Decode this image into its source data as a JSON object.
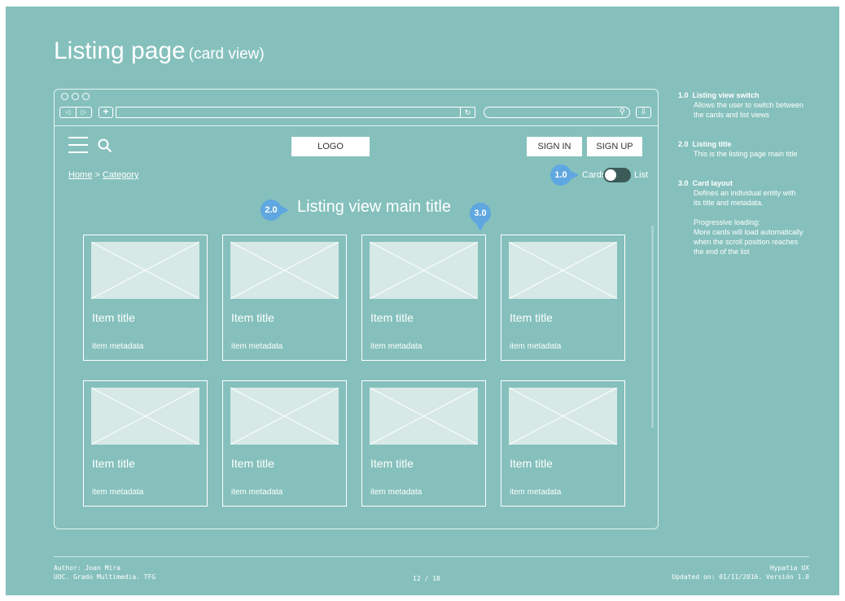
{
  "page": {
    "title": "Listing page",
    "subtitle": "(card view)"
  },
  "browser": {
    "nav_back": "◁",
    "nav_forward": "▷",
    "new_tab": "+",
    "reload": "↻",
    "search_icon": "search-icon",
    "download": "⇩"
  },
  "header": {
    "logo": "LOGO",
    "sign_in": "SIGN IN",
    "sign_up": "SIGN UP"
  },
  "breadcrumb": {
    "home": "Home",
    "separator": ">",
    "category": "Category"
  },
  "view_switch": {
    "cards_label": "Cards",
    "list_label": "List",
    "state": "cards"
  },
  "listing": {
    "title": "Listing view main title"
  },
  "cards": [
    {
      "title": "Item title",
      "metadata": "item metadata"
    },
    {
      "title": "Item title",
      "metadata": "item metadata"
    },
    {
      "title": "Item title",
      "metadata": "item metadata"
    },
    {
      "title": "Item title",
      "metadata": "item metadata"
    },
    {
      "title": "Item title",
      "metadata": "item metadata"
    },
    {
      "title": "Item title",
      "metadata": "item metadata"
    },
    {
      "title": "Item title",
      "metadata": "item metadata"
    },
    {
      "title": "Item title",
      "metadata": "item metadata"
    }
  ],
  "markers": {
    "m1": "1.0",
    "m2": "2.0",
    "m3": "3.0"
  },
  "notes": [
    {
      "num": "1.0",
      "title": "Listing view switch",
      "lines": [
        "Allows the user to switch between",
        "the cards and list views"
      ]
    },
    {
      "num": "2.0",
      "title": "Listing title",
      "lines": [
        "This is the listing page main title"
      ]
    },
    {
      "num": "3.0",
      "title": "Card layout",
      "lines": [
        "Defines an individual entity with",
        "its title and metadata.",
        "",
        "Progressive loading:",
        "More cards will load automatically",
        "when the scroll position reaches",
        "the end of the list"
      ]
    }
  ],
  "footer": {
    "author": "Author: Joan Mira",
    "org": "UOC. Grado Multimedia. TFG",
    "page": "12 / 18",
    "brand": "Hypatia UX",
    "updated": "Updated on: 01/11/2016. Versión 1.0"
  },
  "colors": {
    "background": "#85c0bc",
    "marker": "#5fa7e0",
    "toggle": "#3c5a58"
  }
}
